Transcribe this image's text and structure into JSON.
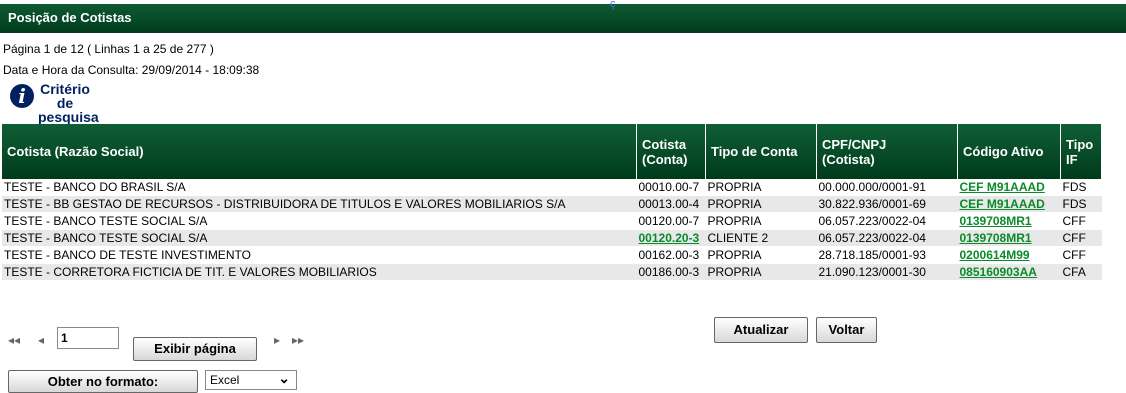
{
  "title": "Posição de Cotistas",
  "title_mark": "ç",
  "page_info": "Página 1 de 12 ( Linhas 1 a 25 de 277 )",
  "query_time": "Data e Hora da Consulta: 29/09/2014 - 18:09:38",
  "criteria": {
    "line1": "Critério de",
    "line2": "pesquisa",
    "icon": "info-icon"
  },
  "table": {
    "headers": {
      "razao": "Cotista (Razão Social)",
      "conta1": "Cotista",
      "conta2": "(Conta)",
      "tipo": "Tipo de Conta",
      "cpf1": "CPF/CNPJ",
      "cpf2": "(Cotista)",
      "codigo": "Código Ativo",
      "tipoif1": "Tipo",
      "tipoif2": "IF"
    },
    "rows": [
      {
        "razao": "TESTE - BANCO DO BRASIL S/A",
        "conta": "00010.00-7",
        "tipo": "PROPRIA",
        "cpf": "00.000.000/0001-91",
        "codigo": "CEF M91AAAD",
        "tipoif": "FDS"
      },
      {
        "razao": "TESTE - BB GESTAO DE RECURSOS - DISTRIBUIDORA DE TITULOS E VALORES MOBILIARIOS S/A",
        "conta": "00013.00-4",
        "tipo": "PROPRIA",
        "cpf": "30.822.936/0001-69",
        "codigo": "CEF M91AAAD",
        "tipoif": "FDS"
      },
      {
        "razao": "TESTE - BANCO TESTE SOCIAL S/A",
        "conta": "00120.00-7",
        "tipo": "PROPRIA",
        "cpf": "06.057.223/0022-04",
        "codigo": "0139708MR1",
        "tipoif": "CFF"
      },
      {
        "razao": "TESTE - BANCO TESTE SOCIAL S/A",
        "conta": "00120.20-3",
        "tipo": "CLIENTE 2",
        "cpf": "06.057.223/0022-04",
        "codigo": "0139708MR1",
        "tipoif": "CFF"
      },
      {
        "razao": "TESTE - BANCO DE TESTE INVESTIMENTO",
        "conta": "00162.00-3",
        "tipo": "PROPRIA",
        "cpf": "28.718.185/0001-93",
        "codigo": "0200614M99",
        "tipoif": "CFF"
      },
      {
        "razao": "TESTE - CORRETORA FICTICIA DE TIT. E VALORES MOBILIARIOS",
        "conta": "00186.00-3",
        "tipo": "PROPRIA",
        "cpf": "21.090.123/0001-30",
        "codigo": "085160903AA",
        "tipoif": "CFA"
      }
    ]
  },
  "pagination": {
    "first": "◂◂",
    "prev": "◂",
    "next": "▸",
    "last": "▸▸",
    "page_value": "1",
    "show_page": "Exibir página"
  },
  "actions": {
    "update": "Atualizar",
    "back": "Voltar"
  },
  "export": {
    "label": "Obter no formato:",
    "format": "Excel"
  }
}
